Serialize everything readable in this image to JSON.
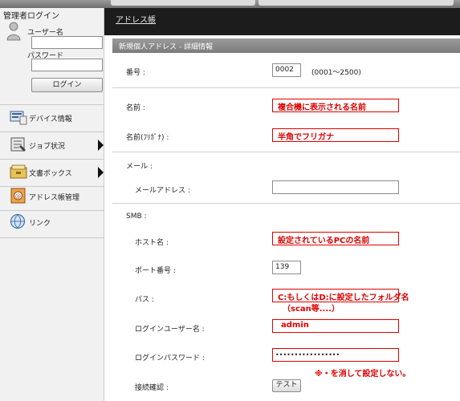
{
  "sidebar": {
    "login": {
      "title": "管理者ログイン",
      "user_label": "ユーザー名",
      "user_value": "",
      "password_label": "パスワード",
      "password_value": "",
      "login_button": "ログイン"
    },
    "items": [
      {
        "label": "デバイス情報",
        "icon": "device-icon",
        "has_arrow": false
      },
      {
        "label": "ジョブ状況",
        "icon": "job-icon",
        "has_arrow": true
      },
      {
        "label": "文書ボックス",
        "icon": "box-icon",
        "has_arrow": true
      },
      {
        "label": "アドレス帳管理",
        "icon": "address-book-icon",
        "has_arrow": false
      },
      {
        "label": "リンク",
        "icon": "link-icon",
        "has_arrow": false
      }
    ]
  },
  "header": {
    "breadcrumb": "アドレス帳"
  },
  "form": {
    "section_title": "新規個人アドレス - 詳細情報",
    "number_label": "番号 :",
    "number_value": "0002",
    "number_range": "(0001～2500)",
    "name_label": "名前 :",
    "furigana_label": "名前(ﾌﾘｶﾞﾅ) :",
    "mail_group": "メール :",
    "mail_label": "メールアドレス :",
    "smb_group": "SMB :",
    "host_label": "ホスト名 :",
    "port_label": "ポート番号 :",
    "port_value": "139",
    "path_label": "パス :",
    "login_user_label": "ログインユーザー名 :",
    "login_user_value": "admin",
    "login_password_label": "ログインパスワード :",
    "login_password_value": "•••••••••••••••••",
    "connection_label": "接続確認 :",
    "test_button": "テスト"
  },
  "annotations": {
    "name": "複合機に表示される名前",
    "furigana": "半角でフリガナ",
    "host": "設定されているPCの名前",
    "path_line1": "C:もしくはD:に設定したフォルダ名",
    "path_line2": "（scan等....）",
    "password_note": "※・を消して設定しない。"
  },
  "colors": {
    "annotation_red": "#e00000",
    "topbar": "#1c1c1c",
    "header_bar": "#8b8b8b"
  }
}
